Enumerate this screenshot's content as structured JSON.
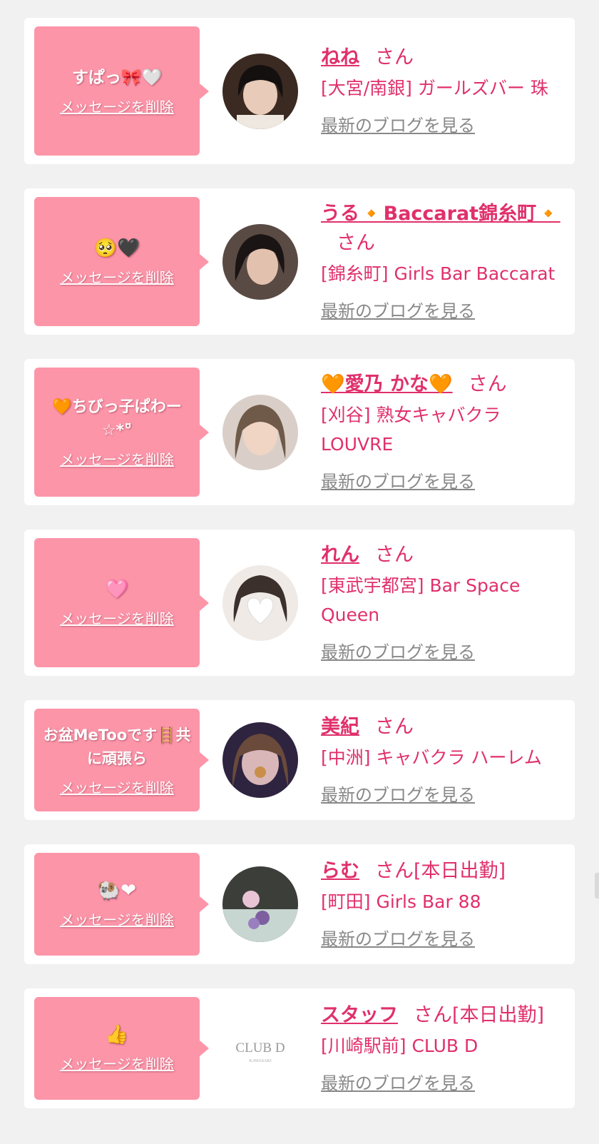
{
  "cards": [
    {
      "message": "すぱっ🎀🤍",
      "delete_label": "メッセージを削除",
      "name": "ねね",
      "name_suffix": "さん",
      "shop": "[大宮/南銀] ガールズバー 珠",
      "blog_label": "最新のブログを見る",
      "avatar": "avatar-photo-dark-hair"
    },
    {
      "message": "🥺🖤",
      "delete_label": "メッセージを削除",
      "name": "うる🔸Baccarat錦糸町🔸",
      "name_suffix": "さん",
      "shop": "[錦糸町] Girls Bar Baccarat",
      "blog_label": "最新のブログを見る",
      "avatar": "avatar-photo-dark-hair"
    },
    {
      "message": "🧡ちびっ子ぱわー☆*°̈",
      "delete_label": "メッセージを削除",
      "name": "🧡愛乃 かな🧡",
      "name_suffix": "さん",
      "shop": "[刈谷] 熟女キャバクラ LOUVRE",
      "blog_label": "最新のブログを見る",
      "avatar": "avatar-photo-light-hair"
    },
    {
      "message": "🩷",
      "delete_label": "メッセージを削除",
      "name": "れん",
      "name_suffix": "さん",
      "shop": "[東武宇都宮] Bar Space Queen",
      "blog_label": "最新のブログを見る",
      "avatar": "avatar-photo-heart-face"
    },
    {
      "message": "お盆MeTooです🪜共に頑張ら",
      "delete_label": "メッセージを削除",
      "name": "美紀",
      "name_suffix": "さん",
      "shop": "[中洲] キャバクラ ハーレム",
      "blog_label": "最新のブログを見る",
      "avatar": "avatar-photo-filter"
    },
    {
      "message": "🐏❤",
      "delete_label": "メッセージを削除",
      "name": "らむ",
      "name_suffix": "さん[本日出勤]",
      "shop": "[町田] Girls Bar 88",
      "blog_label": "最新のブログを見る",
      "avatar": "avatar-photo-bouquet"
    },
    {
      "message": "👍",
      "delete_label": "メッセージを削除",
      "name": "スタッフ",
      "name_suffix": "さん[本日出勤]",
      "shop": "[川崎駅前] CLUB D",
      "blog_label": "最新のブログを見る",
      "avatar": "avatar-logo"
    }
  ],
  "logo_text": "CLUB D",
  "logo_sub": "KAWASAKI",
  "colors": {
    "accent": "#e0306b",
    "bubble": "#fd95a9",
    "link_gray": "#888888",
    "background": "#f1f1f1"
  }
}
